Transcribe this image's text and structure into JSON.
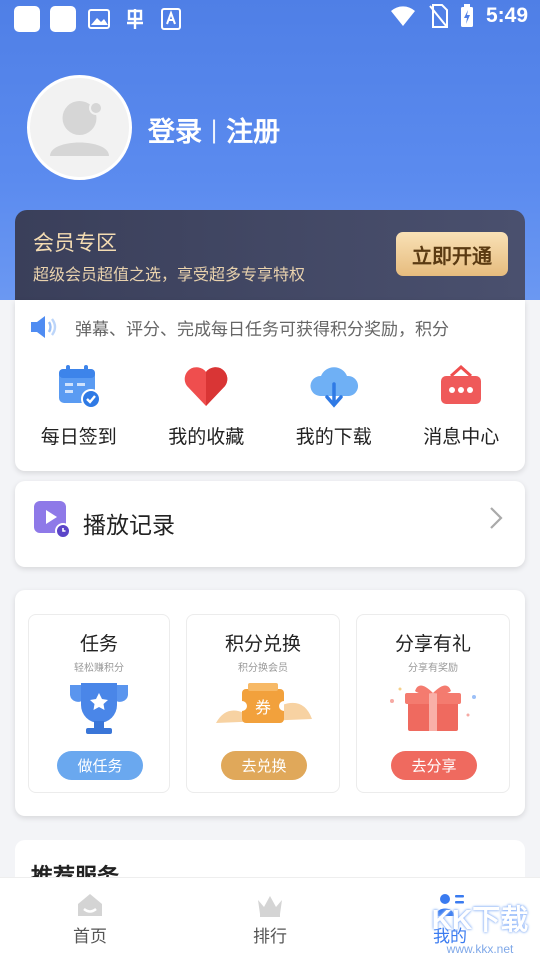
{
  "status_bar": {
    "time": "5:49"
  },
  "profile": {
    "login_label": "登录",
    "separator": "|",
    "register_label": "注册"
  },
  "vip": {
    "title": "会员专区",
    "subtitle": "超级会员超值之选，享受超多专享特权",
    "button_label": "立即开通",
    "colors": {
      "background": "#3a3f5a",
      "accent": "#f4dcb2"
    }
  },
  "notice": {
    "text": "弹幕、评分、完成每日任务可获得积分奖励，积分"
  },
  "quick_actions": [
    {
      "label": "每日签到",
      "icon": "calendar-check-icon"
    },
    {
      "label": "我的收藏",
      "icon": "heart-icon"
    },
    {
      "label": "我的下载",
      "icon": "cloud-download-icon"
    },
    {
      "label": "消息中心",
      "icon": "message-box-icon"
    }
  ],
  "history": {
    "label": "播放记录"
  },
  "tasks": [
    {
      "title": "任务",
      "subtitle": "轻松赚积分",
      "button": "做任务",
      "color": "#6aa8ef"
    },
    {
      "title": "积分兑换",
      "subtitle": "积分换会员",
      "button": "去兑换",
      "color": "#e0a85a"
    },
    {
      "title": "分享有礼",
      "subtitle": "分享有奖励",
      "button": "去分享",
      "color": "#ef6a5f"
    }
  ],
  "recommend": {
    "title": "推荐服务"
  },
  "tabs": [
    {
      "label": "首页",
      "icon": "home-icon",
      "active": false
    },
    {
      "label": "排行",
      "icon": "crown-icon",
      "active": false
    },
    {
      "label": "我的",
      "icon": "user-list-icon",
      "active": true
    }
  ],
  "watermark": {
    "text": "KK下载",
    "url": "www.kkx.net"
  },
  "theme": {
    "primary": "#4f7fe6",
    "active_tab": "#3a7bf0"
  }
}
